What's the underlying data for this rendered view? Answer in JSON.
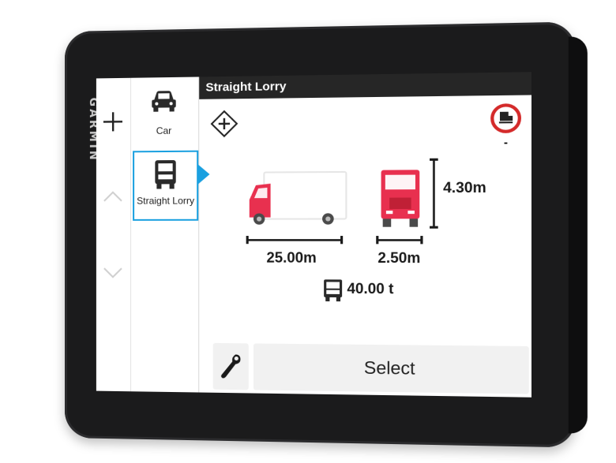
{
  "device": {
    "brand": "GARMIN"
  },
  "header": {
    "title": "Straight Lorry"
  },
  "vehicle_list": [
    {
      "label": "Car",
      "icon": "car-icon",
      "selected": false
    },
    {
      "label": "Straight Lorry",
      "icon": "lorry-icon",
      "selected": true
    }
  ],
  "controls": {
    "add_icon": "plus-icon",
    "scroll_up_icon": "chevron-up-icon",
    "scroll_down_icon": "chevron-down-icon"
  },
  "restriction": {
    "icon": "no-trailer-sign-icon",
    "value": "-"
  },
  "dimensions": {
    "length": "25.00m",
    "width": "2.50m",
    "height": "4.30m",
    "weight": "40.00 t"
  },
  "toolbar": {
    "select_label": "Select",
    "settings_icon": "wrench-icon"
  },
  "colors": {
    "accent": "#1aa0e0",
    "truck_red": "#e8304f",
    "header_bg": "#262626"
  }
}
